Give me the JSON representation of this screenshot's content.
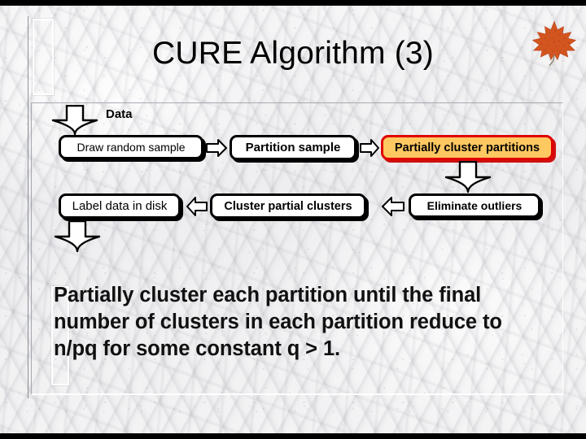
{
  "slide": {
    "title": "CURE Algorithm (3)",
    "decorations": {
      "leaf_icon": "maple-leaf-icon",
      "leaf_color": "#d2541f",
      "background": "white-marble-texture"
    }
  },
  "flowchart": {
    "data_label": "Data",
    "boxes": [
      {
        "id": "draw",
        "label": "Draw random sample",
        "style": "plain",
        "fill": "#ffffff",
        "border": "#000000"
      },
      {
        "id": "partition",
        "label": "Partition sample",
        "style": "bold",
        "fill": "#ffffff",
        "border": "#000000"
      },
      {
        "id": "partially",
        "label": "Partially cluster partitions",
        "style": "highlight",
        "fill": "#ffc861",
        "border": "#e00000"
      },
      {
        "id": "label",
        "label": "Label data in disk",
        "style": "plain",
        "fill": "#ffffff",
        "border": "#000000"
      },
      {
        "id": "cluster",
        "label": "Cluster partial clusters",
        "style": "bold",
        "fill": "#ffffff",
        "border": "#000000"
      },
      {
        "id": "eliminate",
        "label": "Eliminate outliers",
        "style": "bold",
        "fill": "#ffffff",
        "border": "#000000"
      }
    ],
    "arrows": [
      {
        "id": "data-in",
        "direction": "down",
        "icon": "arrow-down-icon"
      },
      {
        "id": "draw-to-partition",
        "direction": "right",
        "icon": "arrow-right-icon"
      },
      {
        "id": "partition-to-partially",
        "direction": "right",
        "icon": "arrow-right-icon"
      },
      {
        "id": "partially-to-eliminate",
        "direction": "down",
        "icon": "arrow-down-icon"
      },
      {
        "id": "eliminate-to-cluster",
        "direction": "left",
        "icon": "arrow-left-icon"
      },
      {
        "id": "cluster-to-label",
        "direction": "left",
        "icon": "arrow-left-icon"
      },
      {
        "id": "label-out",
        "direction": "down",
        "icon": "arrow-down-icon"
      }
    ]
  },
  "body": {
    "text": "Partially cluster each partition until the final number of clusters in each partition reduce to n/pq for some constant q > 1."
  }
}
